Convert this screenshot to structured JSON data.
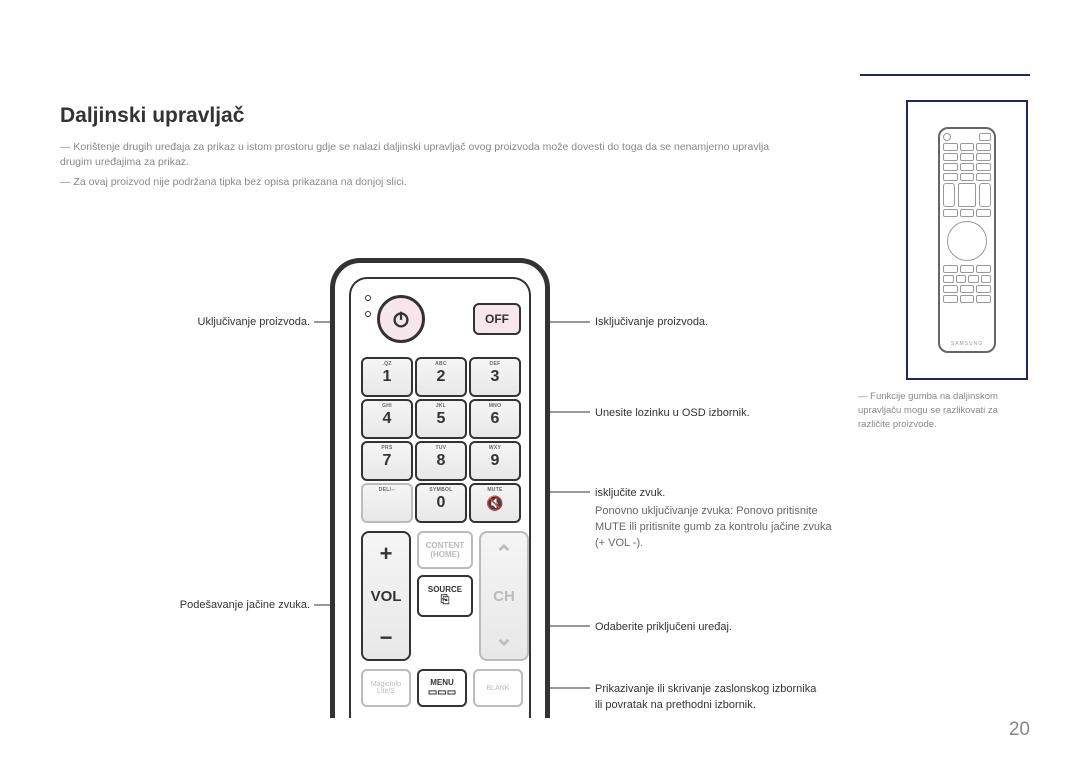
{
  "title": "Daljinski upravljač",
  "notes": {
    "n1": "Korištenje drugih uređaja za prikaz u istom prostoru gdje se nalazi daljinski upravljač ovog proizvoda može dovesti do toga da se nenamjerno upravlja drugim uređajima za prikaz.",
    "n2": "Za ovaj proizvod nije podržana tipka bez opisa prikazana na donjoj slici."
  },
  "remote": {
    "off_label": "OFF",
    "keys": {
      "1": {
        "num": "1",
        "sup": ".QZ"
      },
      "2": {
        "num": "2",
        "sup": "ABC"
      },
      "3": {
        "num": "3",
        "sup": "DEF"
      },
      "4": {
        "num": "4",
        "sup": "GHI"
      },
      "5": {
        "num": "5",
        "sup": "JKL"
      },
      "6": {
        "num": "6",
        "sup": "MNO"
      },
      "7": {
        "num": "7",
        "sup": "PRS"
      },
      "8": {
        "num": "8",
        "sup": "TUV"
      },
      "9": {
        "num": "9",
        "sup": "WXY"
      },
      "del": {
        "num": "",
        "sup": "DEL/--"
      },
      "0": {
        "num": "0",
        "sup": "SYMBOL"
      },
      "mute": {
        "num": "",
        "sup": "MUTE"
      }
    },
    "vol_label": "VOL",
    "ch_label": "CH",
    "content_label": "CONTENT",
    "home_label": "(HOME)",
    "source_label": "SOURCE",
    "magicinfo_label": "MagicInfo",
    "magicinfo_sub": "Lite/S",
    "menu_label": "MENU",
    "blank_label": "BLANK",
    "brand": "SAMSUNG"
  },
  "callouts": {
    "left1": "Uključivanje proizvoda.",
    "left2": "Podešavanje jačine zvuka.",
    "right1": "Isključivanje proizvoda.",
    "right2": "Unesite lozinku u OSD izbornik.",
    "right3": "isključite zvuk.",
    "right3b": "Ponovno uključivanje zvuka: Ponovo pritisnite MUTE ili pritisnite gumb za kontrolu jačine zvuka (+ VOL -).",
    "right4": "Odaberite priključeni uređaj.",
    "right5": "Prikazivanje ili skrivanje zaslonskog izbornika ili povratak na prethodni izbornik."
  },
  "side_note": "Funkcije gumba na daljinskom upravljaču mogu se razlikovati za različite proizvode.",
  "page_number": "20"
}
